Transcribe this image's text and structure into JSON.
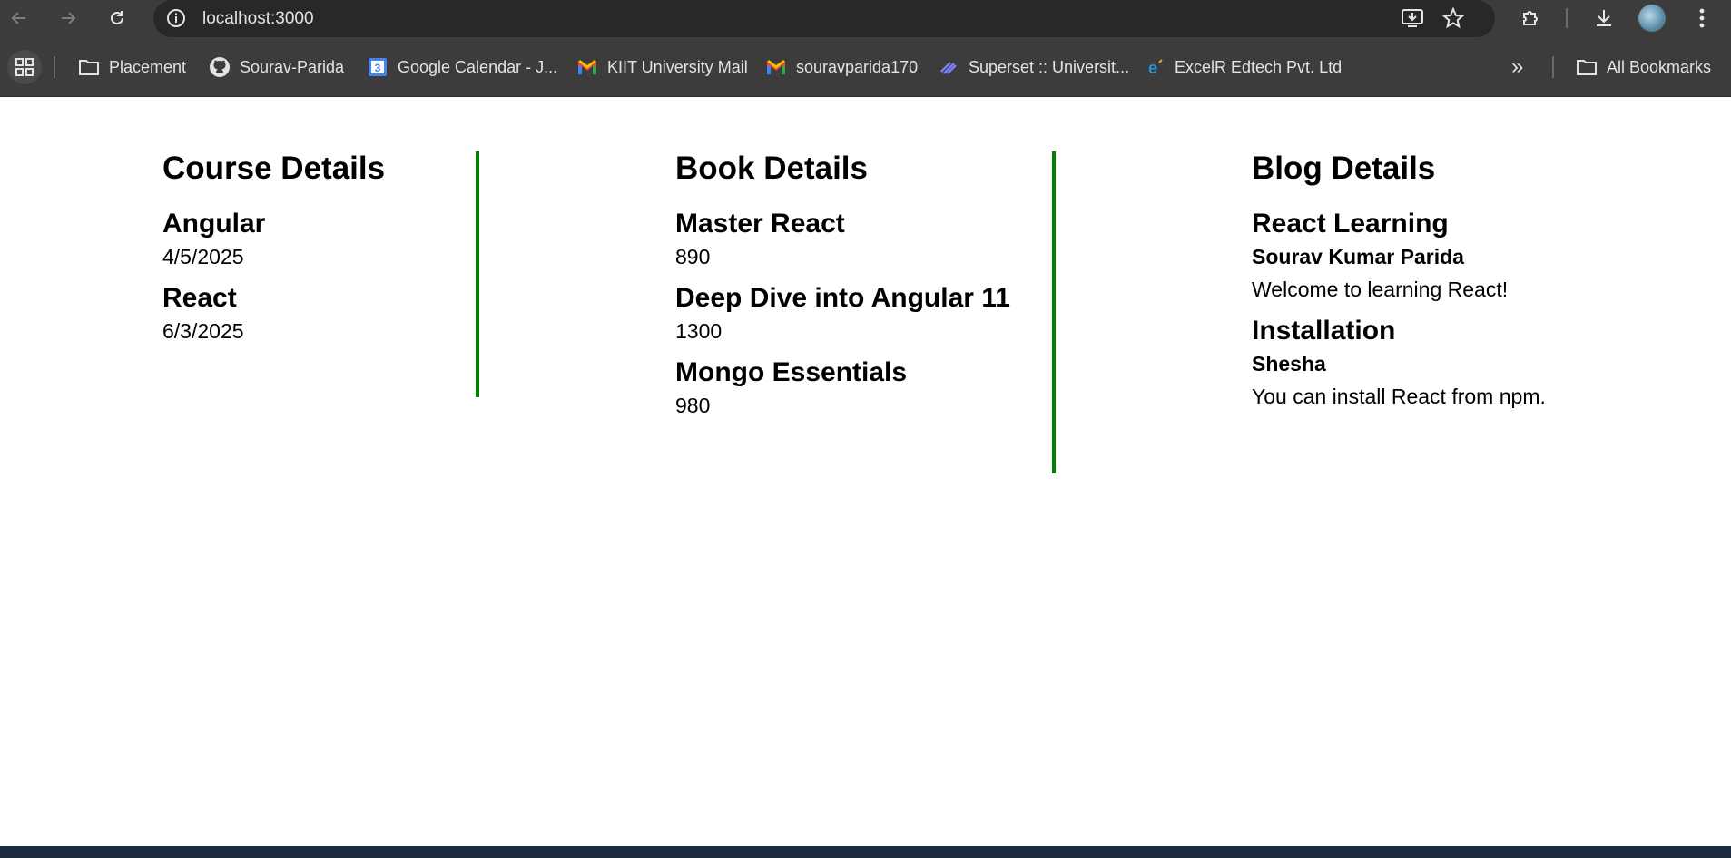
{
  "browser": {
    "url": "localhost:3000",
    "bookmarks": [
      {
        "label": "Placement",
        "icon": "folder-icon"
      },
      {
        "label": "Sourav-Parida",
        "icon": "github-icon"
      },
      {
        "label": "Google Calendar - J...",
        "icon": "google-calendar-icon"
      },
      {
        "label": "KIIT University Mail",
        "icon": "gmail-icon"
      },
      {
        "label": "souravparida170",
        "icon": "gmail-icon"
      },
      {
        "label": "Superset :: Universit...",
        "icon": "superset-icon"
      },
      {
        "label": "ExcelR Edtech Pvt. Ltd",
        "icon": "excelr-icon"
      }
    ],
    "more_label": "»",
    "all_bookmarks_label": "All Bookmarks"
  },
  "courses": {
    "title": "Course Details",
    "items": [
      {
        "name": "Angular",
        "date": "4/5/2025"
      },
      {
        "name": "React",
        "date": "6/3/2025"
      }
    ]
  },
  "books": {
    "title": "Book Details",
    "items": [
      {
        "name": "Master React",
        "price": "890"
      },
      {
        "name": "Deep Dive into Angular 11",
        "price": "1300"
      },
      {
        "name": "Mongo Essentials",
        "price": "980"
      }
    ]
  },
  "blogs": {
    "title": "Blog Details",
    "items": [
      {
        "title": "React Learning",
        "author": "Sourav Kumar Parida",
        "content": "Welcome to learning React!"
      },
      {
        "title": "Installation",
        "author": "Shesha",
        "content": "You can install React from npm."
      }
    ]
  },
  "colors": {
    "divider": "#008000",
    "chrome_bg": "#3c3c3c",
    "omnibox_bg": "#282828"
  }
}
